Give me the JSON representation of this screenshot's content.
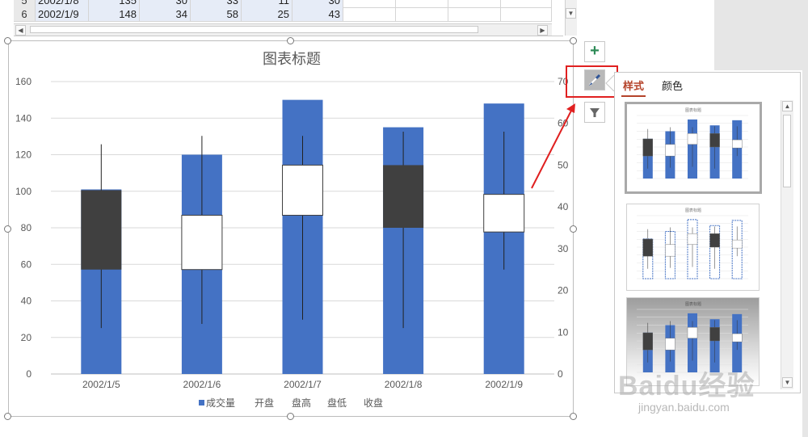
{
  "spreadsheet": {
    "rows": [
      {
        "row": "5",
        "date": "2002/1/8",
        "values": [
          "135",
          "30",
          "33",
          "11",
          "30"
        ]
      },
      {
        "row": "6",
        "date": "2002/1/9",
        "values": [
          "148",
          "34",
          "58",
          "25",
          "43"
        ]
      }
    ]
  },
  "chart": {
    "title": "图表标题",
    "legend": [
      "成交量",
      "开盘",
      "盘高",
      "盘低",
      "收盘"
    ]
  },
  "side_buttons": {
    "plus": "+",
    "brush": "brush-icon",
    "filter": "filter-icon"
  },
  "style_pane": {
    "tab_style": "样式",
    "tab_color": "颜色",
    "thumb_title": "图表标题"
  },
  "watermark": {
    "brand": "Baidu经验",
    "url": "jingyan.baidu.com"
  },
  "colors": {
    "volume": "#4472C4",
    "down_box": "#404040",
    "up_box": "#ffffff",
    "highlight": "#e02020"
  },
  "chart_data": {
    "type": "bar",
    "title": "图表标题",
    "categories": [
      "2002/1/5",
      "2002/1/6",
      "2002/1/7",
      "2002/1/8",
      "2002/1/9"
    ],
    "series": [
      {
        "name": "成交量",
        "axis": "left",
        "values": [
          101,
          120,
          150,
          135,
          148
        ]
      },
      {
        "name": "开盘",
        "axis": "right",
        "values": [
          44,
          25,
          38,
          50,
          34
        ]
      },
      {
        "name": "盘高",
        "axis": "right",
        "values": [
          55,
          57,
          57,
          58,
          58
        ]
      },
      {
        "name": "盘低",
        "axis": "right",
        "values": [
          11,
          12,
          13,
          11,
          25
        ]
      },
      {
        "name": "收盘",
        "axis": "right",
        "values": [
          25,
          38,
          50,
          35,
          43
        ]
      }
    ],
    "ylim": [
      0,
      160
    ],
    "yticks": [
      0,
      20,
      40,
      60,
      80,
      100,
      120,
      140,
      160
    ],
    "y2lim": [
      0,
      70
    ],
    "y2ticks": [
      0,
      10,
      20,
      30,
      40,
      50,
      60,
      70
    ],
    "grid": true,
    "legend": "bottom"
  }
}
